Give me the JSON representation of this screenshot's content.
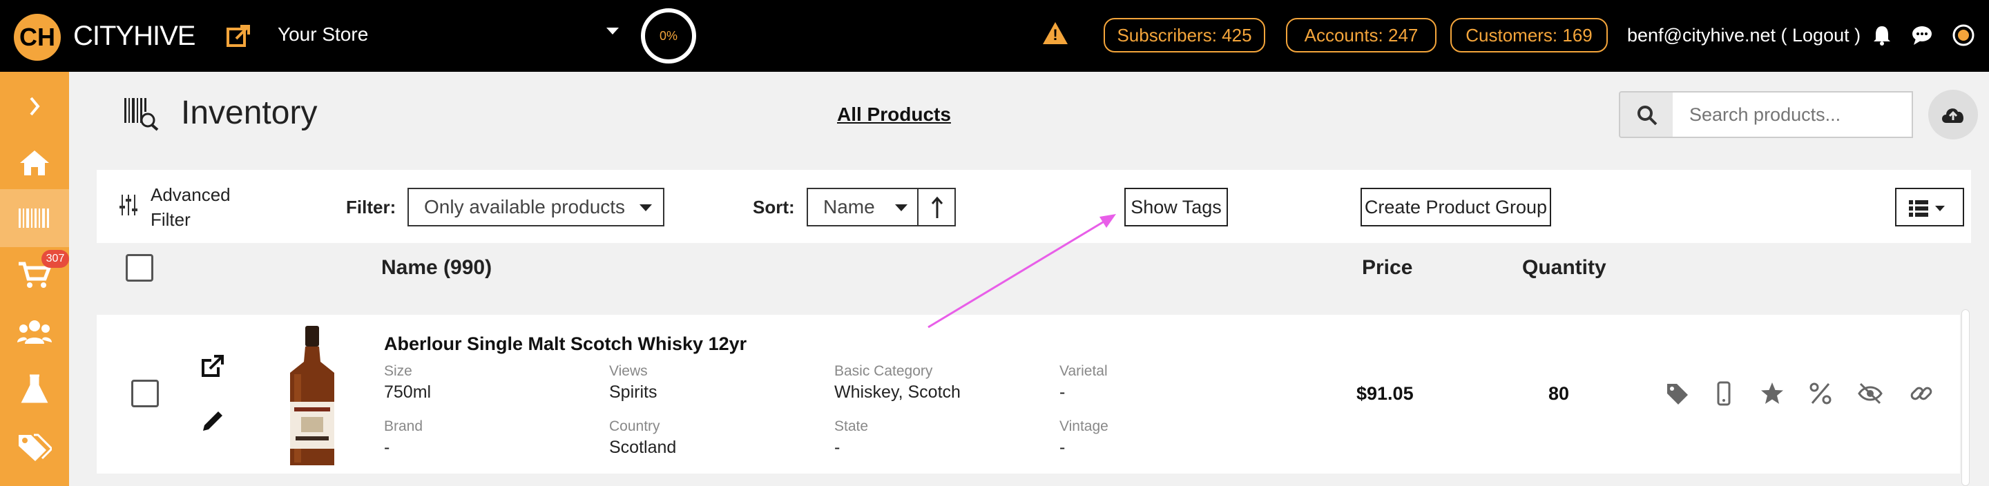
{
  "header": {
    "logo_text": "CITYHIVE",
    "logo_mark": "CH",
    "store_name": "Your Store",
    "progress": "0%",
    "subscribers": "Subscribers: 425",
    "accounts": "Accounts: 247",
    "customers": "Customers: 169",
    "user": "benf@cityhive.net ( Logout )",
    "accent_color": "#f4a53b"
  },
  "sidebar": {
    "items": [
      {
        "name": "expand",
        "icon": "chevron-right-icon"
      },
      {
        "name": "home",
        "icon": "home-icon"
      },
      {
        "name": "inventory",
        "icon": "barcode-icon",
        "active": true
      },
      {
        "name": "orders",
        "icon": "cart-icon",
        "badge": "307"
      },
      {
        "name": "customers",
        "icon": "users-icon"
      },
      {
        "name": "lab",
        "icon": "flask-icon"
      },
      {
        "name": "promotions",
        "icon": "tags-icon"
      }
    ]
  },
  "page": {
    "title": "Inventory",
    "all_products": "All Products",
    "search_placeholder": "Search products..."
  },
  "toolbar": {
    "advanced_filter": "Advanced Filter",
    "filter_label": "Filter:",
    "filter_value": "Only available products",
    "sort_label": "Sort:",
    "sort_value": "Name",
    "show_tags": "Show Tags",
    "create_group": "Create Product Group"
  },
  "table": {
    "columns": {
      "name": "Name  (990)",
      "price": "Price",
      "quantity": "Quantity"
    },
    "rows": [
      {
        "name": "Aberlour Single Malt Scotch Whisky 12yr",
        "fields": {
          "size_label": "Size",
          "size": "750ml",
          "views_label": "Views",
          "views": "Spirits",
          "category_label": "Basic Category",
          "category": "Whiskey, Scotch",
          "varietal_label": "Varietal",
          "varietal": "-",
          "brand_label": "Brand",
          "brand": "-",
          "country_label": "Country",
          "country": "Scotland",
          "state_label": "State",
          "state": "-",
          "vintage_label": "Vintage",
          "vintage": "-"
        },
        "price": "$91.05",
        "quantity": "80"
      }
    ]
  }
}
